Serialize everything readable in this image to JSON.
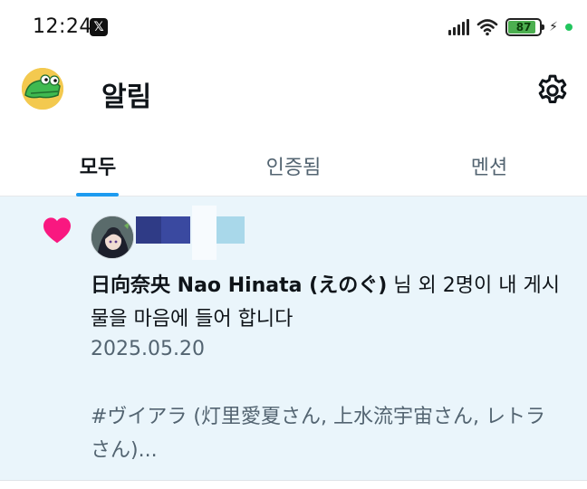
{
  "status_bar": {
    "time": "12:24",
    "app_icon": "x-logo-icon",
    "battery_level": "87",
    "battery_fraction": 0.87,
    "icons": [
      "signal-icon",
      "wifi-icon",
      "battery-icon",
      "charging-bolt-icon",
      "green-dot-indicator"
    ]
  },
  "header": {
    "title": "알림",
    "avatar_icon": "green-dinosaur-avatar",
    "settings_icon": "gear-icon"
  },
  "tabs": [
    {
      "label": "모두",
      "active": true
    },
    {
      "label": "인증됨",
      "active": false
    },
    {
      "label": "멘션",
      "active": false
    }
  ],
  "notification": {
    "type_icon": "heart-icon",
    "actor_name": "日向奈央 Nao Hinata (えのぐ)",
    "action_text": " 님 외 2명이 내 게시물을 마음에 들어 합니다",
    "date": "2025.05.20",
    "post_snippet": "#ヴイアラ (灯里愛夏さん, 上水流宇宙さん, レトラさん)...",
    "colors": {
      "background": "#eaf5fb",
      "heart": "#f91880"
    }
  }
}
